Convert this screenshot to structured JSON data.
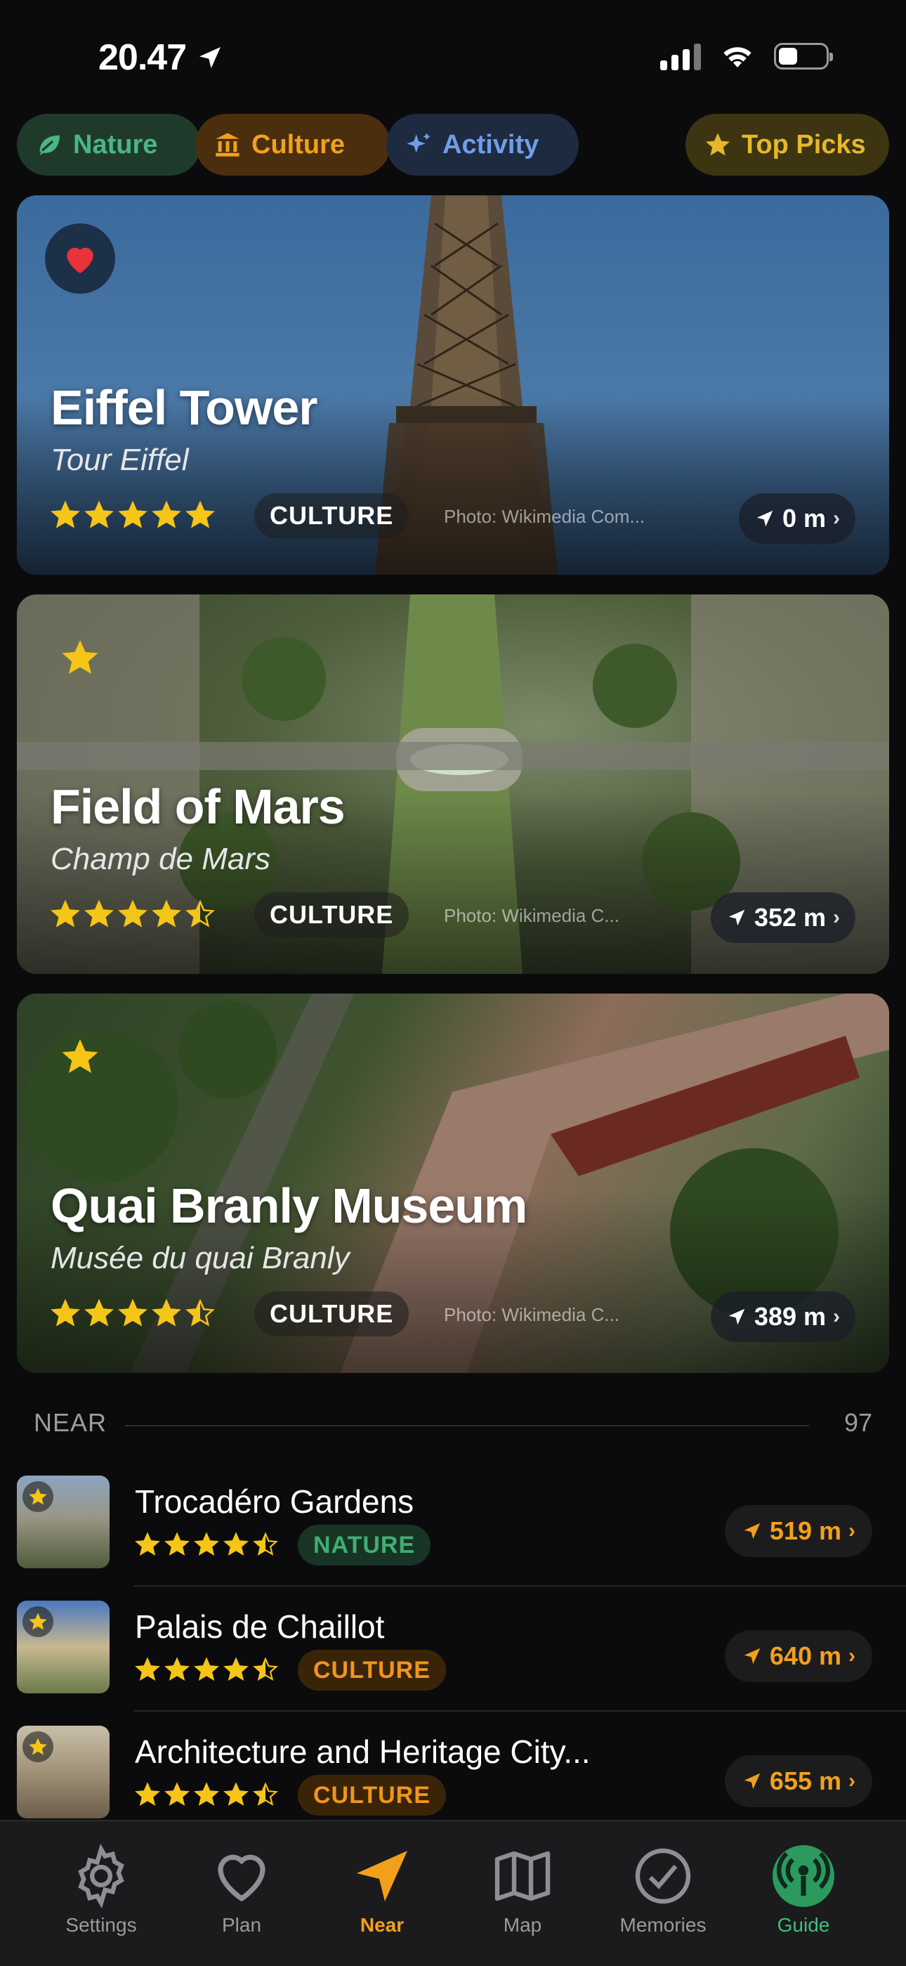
{
  "status_bar": {
    "time": "20.47"
  },
  "filters": [
    {
      "label": "Nature",
      "icon": "leaf-icon",
      "color": "#49b784"
    },
    {
      "label": "Culture",
      "icon": "museum-icon",
      "color": "#f2a01c"
    },
    {
      "label": "Activity",
      "icon": "sparkle-icon",
      "color": "#6f9ee8"
    },
    {
      "label": "Top Picks",
      "icon": "star-icon",
      "color": "#e5b72a"
    }
  ],
  "featured": [
    {
      "title": "Eiffel Tower",
      "subtitle": "Tour Eiffel",
      "rating": 5,
      "category": "CULTURE",
      "credit": "Photo: Wikimedia Com...",
      "distance": "0 m",
      "badge": "heart-icon"
    },
    {
      "title": "Field of Mars",
      "subtitle": "Champ de Mars",
      "rating": 4.5,
      "category": "CULTURE",
      "credit": "Photo: Wikimedia C...",
      "distance": "352 m",
      "badge": "star-icon"
    },
    {
      "title": "Quai Branly Museum",
      "subtitle": "Musée du quai Branly",
      "rating": 4.5,
      "category": "CULTURE",
      "credit": "Photo: Wikimedia C...",
      "distance": "389 m",
      "badge": "star-icon"
    }
  ],
  "near": {
    "label": "NEAR",
    "count": "97",
    "items": [
      {
        "name": "Trocadéro Gardens",
        "rating": 4.5,
        "category": "NATURE",
        "distance": "519 m"
      },
      {
        "name": "Palais de Chaillot",
        "rating": 4.5,
        "category": "CULTURE",
        "distance": "640 m"
      },
      {
        "name": "Architecture and Heritage City...",
        "rating": 4.5,
        "category": "CULTURE",
        "distance": "655 m"
      }
    ]
  },
  "tabs": [
    {
      "label": "Settings",
      "icon": "gear-icon"
    },
    {
      "label": "Plan",
      "icon": "heart-icon"
    },
    {
      "label": "Near",
      "icon": "location-arrow-icon",
      "active": true
    },
    {
      "label": "Map",
      "icon": "map-icon"
    },
    {
      "label": "Memories",
      "icon": "checkmark-circle-icon"
    },
    {
      "label": "Guide",
      "icon": "broadcast-icon"
    }
  ],
  "colors": {
    "accent": "#f2a01c",
    "star": "#f5c518",
    "background": "#0b0b0d"
  }
}
